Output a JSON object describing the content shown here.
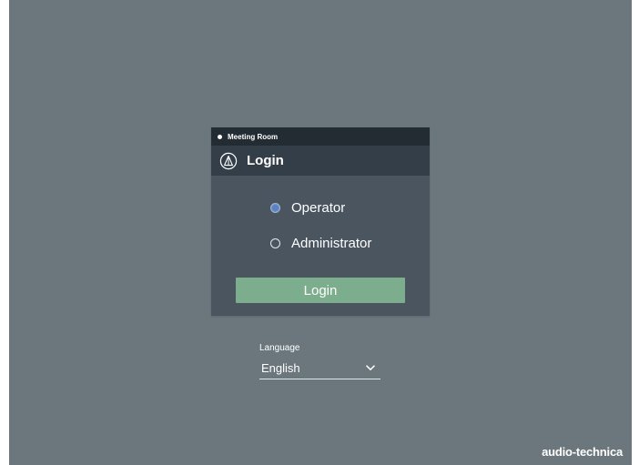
{
  "room": {
    "name": "Meeting Room"
  },
  "dialog": {
    "title": "Login",
    "options": [
      {
        "label": "Operator",
        "selected": true
      },
      {
        "label": "Administrator",
        "selected": false
      }
    ],
    "login_button": "Login"
  },
  "language": {
    "label": "Language",
    "selected": "English"
  },
  "brand": {
    "name": "audio-technica"
  },
  "icons": {
    "logo": "audio-technica-logo-icon",
    "status_dot": "status-dot-icon",
    "dropdown": "chevron-down-icon"
  },
  "colors": {
    "background": "#6b777d",
    "dialog_body": "#4a5560",
    "title_bar": "#333e48",
    "room_bar": "#242c33",
    "login_button": "#7cae8d",
    "radio_selected": "#5b82c2"
  }
}
